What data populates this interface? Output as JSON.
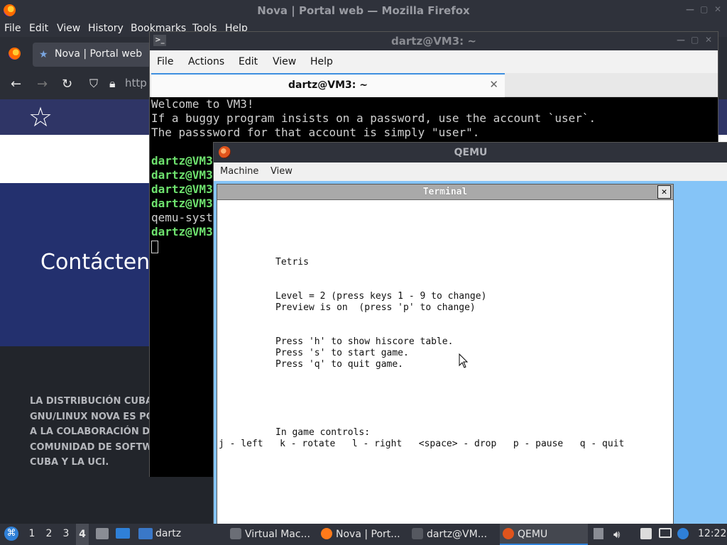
{
  "firefox": {
    "window_title": "Nova | Portal web — Mozilla Firefox",
    "menu": [
      "File",
      "Edit",
      "View",
      "History",
      "Bookmarks",
      "Tools",
      "Help"
    ],
    "tab_label": "Nova | Portal web",
    "url_partial": "http",
    "page": {
      "contact_heading": "Contácten",
      "footer_lines": [
        "LA DISTRIBUCIÓN CUBAN",
        "GNU/LINUX NOVA ES POS",
        "A LA COLABORACIÓN DE",
        "COMUNIDAD DE SOFTWA",
        "CUBA Y LA UCI."
      ]
    }
  },
  "terminal": {
    "window_title": "dartz@VM3: ~",
    "menu": [
      "File",
      "Actions",
      "Edit",
      "View",
      "Help"
    ],
    "tab_label": "dartz@VM3: ~",
    "lines": [
      {
        "text": "Welcome to VM3!",
        "style": "normal"
      },
      {
        "text": "If a buggy program insists on a password, use the account `user`.",
        "style": "normal"
      },
      {
        "text": "The passsword for that account is simply \"user\".",
        "style": "normal"
      },
      {
        "text": "",
        "style": "normal"
      },
      {
        "text": "dartz@VM3",
        "style": "prompt"
      },
      {
        "text": "dartz@VM3",
        "style": "prompt"
      },
      {
        "text": "dartz@VM3",
        "style": "prompt"
      },
      {
        "text": "dartz@VM3",
        "style": "prompt"
      },
      {
        "text": "qemu-syst",
        "style": "normal"
      },
      {
        "text": "dartz@VM3",
        "style": "prompt"
      }
    ]
  },
  "qemu": {
    "window_title": "QEMU",
    "menu": [
      "Machine",
      "View"
    ],
    "vt_title": "Terminal",
    "vt_close": "✕",
    "vt_lines": [
      {
        "text": "Tetris",
        "row": 5,
        "col": 10
      },
      {
        "text": "Level = 2 (press keys 1 - 9 to change)",
        "row": 8,
        "col": 10
      },
      {
        "text": "Preview is on  (press 'p' to change)",
        "row": 9,
        "col": 10
      },
      {
        "text": "Press 'h' to show hiscore table.",
        "row": 12,
        "col": 10
      },
      {
        "text": "Press 's' to start game.",
        "row": 13,
        "col": 10
      },
      {
        "text": "Press 'q' to quit game.",
        "row": 14,
        "col": 10
      },
      {
        "text": "In game controls:",
        "row": 20,
        "col": 10
      },
      {
        "text": "j - left   k - rotate   l - right   <space> - drop   p - pause   q - quit",
        "row": 21,
        "col": 0
      }
    ]
  },
  "taskbar": {
    "workspaces": [
      "1",
      "2",
      "3",
      "4"
    ],
    "active_workspace": "4",
    "folder_label": "dartz",
    "tasks": [
      {
        "label": "Virtual Mac...",
        "icon": "virtualbox-icon",
        "color": "#6b6e76"
      },
      {
        "label": "Nova | Port...",
        "icon": "firefox-icon",
        "color": "#ff7a1a"
      },
      {
        "label": "dartz@VM...",
        "icon": "terminal-icon",
        "color": "#555860"
      },
      {
        "label": "QEMU",
        "icon": "qemu-icon",
        "color": "#e0541c"
      }
    ],
    "clock": "12:22"
  },
  "colors": {
    "prompt_green": "#6ee26e",
    "qemu_bg": "#85c4f7",
    "accent": "#2f80d8"
  }
}
